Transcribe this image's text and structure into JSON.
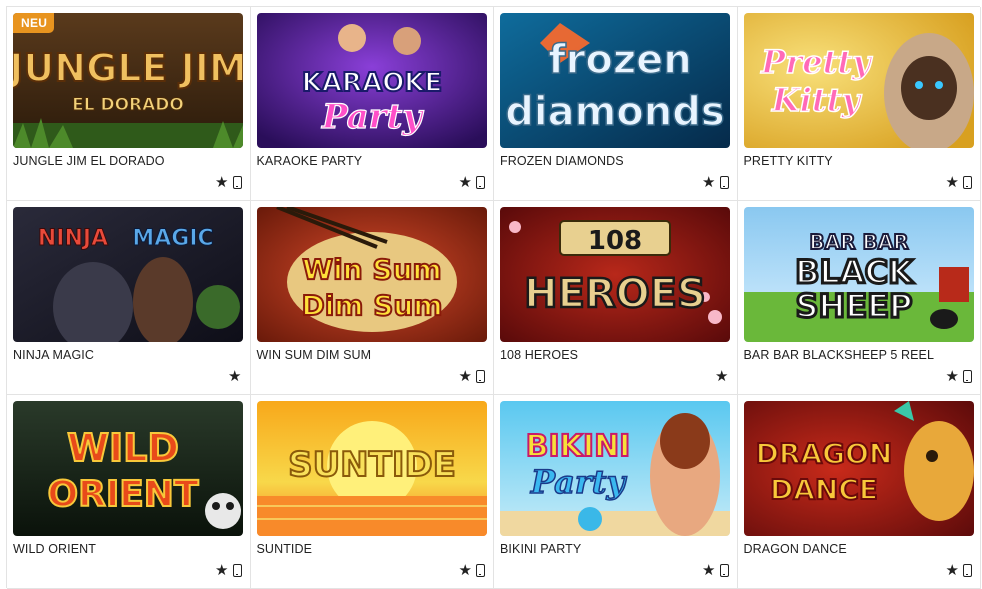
{
  "badge_new": "NEU",
  "games": [
    {
      "title": "JUNGLE JIM EL DORADO",
      "art_line1": "JUNGLE JIM",
      "art_line2": "EL DORADO",
      "favorite_icon": "star-icon",
      "mobile_icon": "mobile-icon"
    },
    {
      "title": "KARAOKE PARTY",
      "art_line1": "KARAOKE",
      "art_line2": "Party",
      "favorite_icon": "star-icon",
      "mobile_icon": "mobile-icon"
    },
    {
      "title": "FROZEN DIAMONDS",
      "art_line1": "frozen",
      "art_line2": "diamonds",
      "favorite_icon": "star-icon",
      "mobile_icon": "mobile-icon"
    },
    {
      "title": "PRETTY KITTY",
      "art_line1": "Pretty",
      "art_line2": "Kitty",
      "favorite_icon": "star-icon",
      "mobile_icon": "mobile-icon"
    },
    {
      "title": "NINJA MAGIC",
      "art_line1": "NINJA",
      "art_line2": "MAGIC",
      "favorite_icon": "star-icon"
    },
    {
      "title": "WIN SUM DIM SUM",
      "art_line1": "Win Sum",
      "art_line2": "Dim Sum",
      "favorite_icon": "star-icon",
      "mobile_icon": "mobile-icon"
    },
    {
      "title": "108 HEROES",
      "art_line1": "108",
      "art_line2": "HEROES",
      "favorite_icon": "star-icon"
    },
    {
      "title": "BAR BAR BLACKSHEEP 5 REEL",
      "art_line1": "BAR BAR",
      "art_line2": "BLACK",
      "art_line3": "SHEEP",
      "favorite_icon": "star-icon",
      "mobile_icon": "mobile-icon"
    },
    {
      "title": "WILD ORIENT",
      "art_line1": "WILD",
      "art_line2": "ORIENT",
      "favorite_icon": "star-icon",
      "mobile_icon": "mobile-icon"
    },
    {
      "title": "SUNTIDE",
      "art_line1": "SUNTIDE",
      "favorite_icon": "star-icon",
      "mobile_icon": "mobile-icon"
    },
    {
      "title": "BIKINI PARTY",
      "art_line1": "BIKINI",
      "art_line2": "Party",
      "favorite_icon": "star-icon",
      "mobile_icon": "mobile-icon"
    },
    {
      "title": "DRAGON DANCE",
      "art_line1": "DRAGON",
      "art_line2": "DANCE",
      "favorite_icon": "star-icon",
      "mobile_icon": "mobile-icon"
    }
  ],
  "colors": {
    "badge": "#e8941f",
    "border": "#e3e3e3",
    "text": "#222222"
  }
}
